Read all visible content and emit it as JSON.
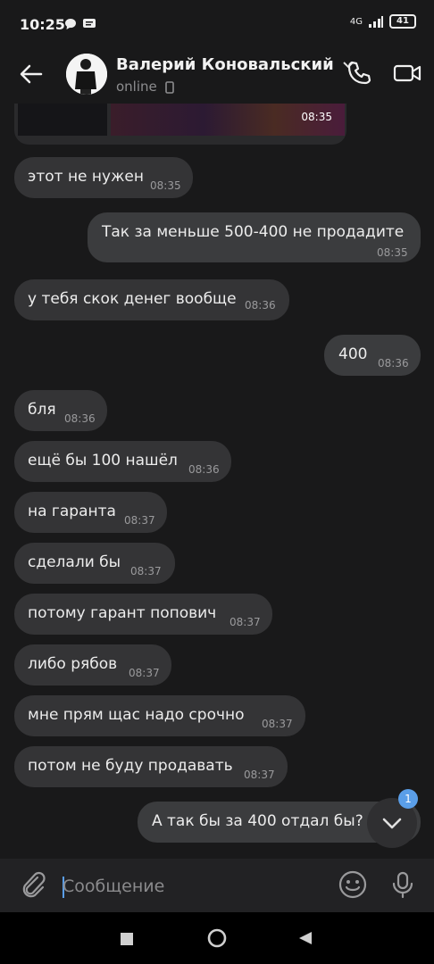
{
  "status_bar": {
    "time": "10:25",
    "network": "4G",
    "battery": "41"
  },
  "header": {
    "contact_name": "Валерий Коновальский",
    "status": "online"
  },
  "media": {
    "time": "08:35"
  },
  "messages": [
    {
      "side": "in",
      "text": "этот не нужен",
      "time": "08:35"
    },
    {
      "side": "out",
      "text": "Так за меньше 500-400 не продадите",
      "time": "08:35"
    },
    {
      "side": "in",
      "text": "у тебя скок денег вообще",
      "time": "08:36"
    },
    {
      "side": "out",
      "text": "400",
      "time": "08:36"
    },
    {
      "side": "in",
      "text": "бля",
      "time": "08:36"
    },
    {
      "side": "in",
      "text": "ещё бы 100 нашёл",
      "time": "08:36"
    },
    {
      "side": "in",
      "text": "на гаранта",
      "time": "08:37"
    },
    {
      "side": "in",
      "text": "сделали бы",
      "time": "08:37"
    },
    {
      "side": "in",
      "text": "потому гарант попович",
      "time": "08:37"
    },
    {
      "side": "in",
      "text": "либо рябов",
      "time": "08:37"
    },
    {
      "side": "in",
      "text": "мне прям щас надо срочно",
      "time": "08:37"
    },
    {
      "side": "in",
      "text": "потом не буду продавать",
      "time": "08:37"
    },
    {
      "side": "out",
      "text": "А так бы за 400 отдал бы?",
      "time": ""
    }
  ],
  "scroll_down": {
    "unread_count": "1"
  },
  "composer": {
    "placeholder": "Сообщение"
  },
  "colors": {
    "accent": "#5a9ee8",
    "background": "#19191a",
    "bubble": "#343436"
  },
  "icons": {
    "back": "arrow-left-icon",
    "call": "phone-icon",
    "video": "video-camera-icon",
    "attach": "paperclip-icon",
    "emoji": "smile-icon",
    "mic": "microphone-icon"
  }
}
